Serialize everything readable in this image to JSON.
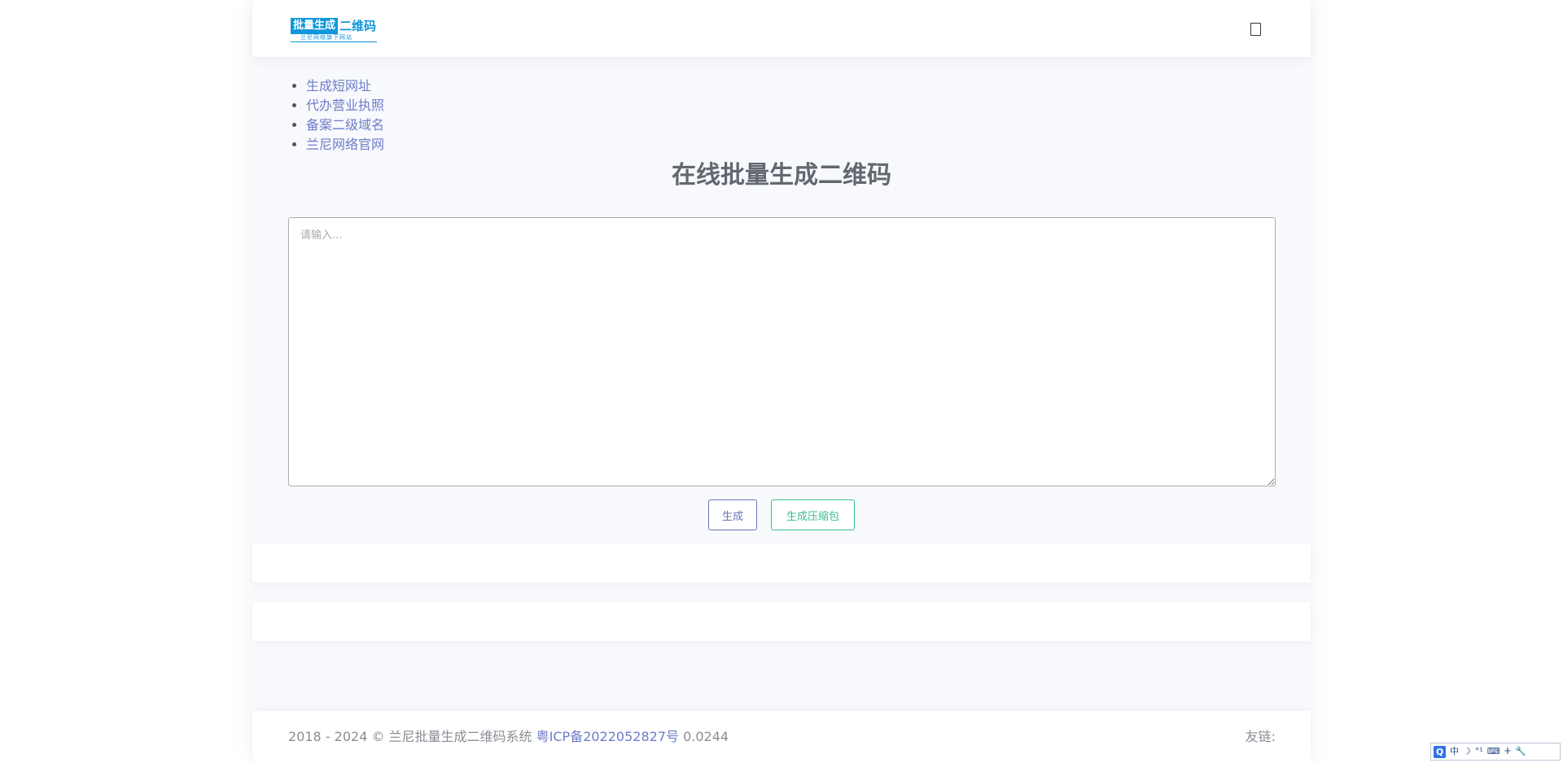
{
  "header": {
    "logo": {
      "main": "批量生成",
      "accent": "二维码",
      "sub": "兰尼网络旗下网站"
    },
    "menu_icon": "menu-icon"
  },
  "nav": {
    "items": [
      {
        "label": "生成短网址"
      },
      {
        "label": "代办营业执照"
      },
      {
        "label": "备案二级域名"
      },
      {
        "label": "兰尼网络官网"
      }
    ]
  },
  "main": {
    "title": "在线批量生成二维码",
    "input_placeholder": "请输入...",
    "generate_label": "生成",
    "zip_label": "生成压缩包"
  },
  "footer": {
    "copyright": "2018 - 2024 © 兰尼批量生成二维码系统",
    "icp": "粤ICP备2022052827号",
    "timing": "0.0244",
    "links_label": "友链:"
  },
  "ime": {
    "logo": "Q",
    "mode": "中",
    "moon": "☽",
    "punct": "°¹",
    "keyboard": "⌨",
    "skin": "ⵜ",
    "tools": "🔧"
  },
  "colors": {
    "link": "#6d7cc8",
    "generate_button": "#6d73b8",
    "zip_button": "#3cbf8d",
    "logo_blue": "#1296db"
  }
}
